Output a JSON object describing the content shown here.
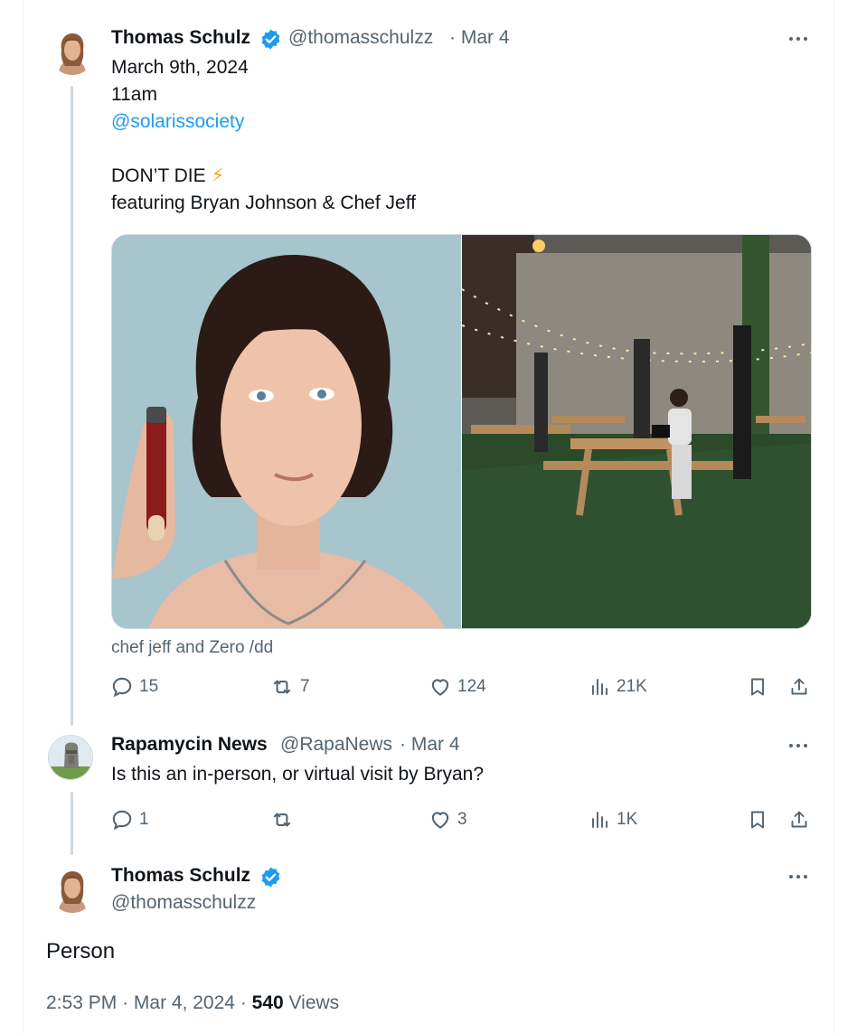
{
  "tweet1": {
    "author_name": "Thomas Schulz",
    "handle": "@thomasschulzz",
    "date": "· Mar 4",
    "lines": [
      "March 9th, 2024",
      "11am"
    ],
    "mention": "@solarissociety",
    "headline": "DON’T DIE",
    "headline_emoji": "⚡",
    "featuring": "featuring Bryan Johnson & Chef Jeff",
    "images": [
      {
        "description_icon": "photo-portrait-with-blood-vial"
      },
      {
        "description_icon": "photo-outdoor-patio-with-picnic-tables"
      }
    ],
    "caption": "chef jeff and Zero /dd",
    "stats": {
      "replies": "15",
      "reposts": "7",
      "likes": "124",
      "views": "21K"
    }
  },
  "tweet2": {
    "author_name": "Rapamycin News",
    "handle": "@RapaNews",
    "date": "· Mar 4",
    "text": "Is this an in-person, or virtual visit by Bryan?",
    "stats": {
      "replies": "1",
      "reposts": "",
      "likes": "3",
      "views": "1K"
    }
  },
  "tweet3": {
    "author_name": "Thomas Schulz",
    "handle": "@thomasschulzz",
    "text": "Person",
    "time": "2:53 PM",
    "date": "Mar 4, 2024",
    "views_count": "540",
    "views_label": "Views"
  },
  "colors": {
    "verified": "#1d9bf0",
    "link": "#1d9bf0",
    "muted": "#536471",
    "text": "#0f1419"
  }
}
